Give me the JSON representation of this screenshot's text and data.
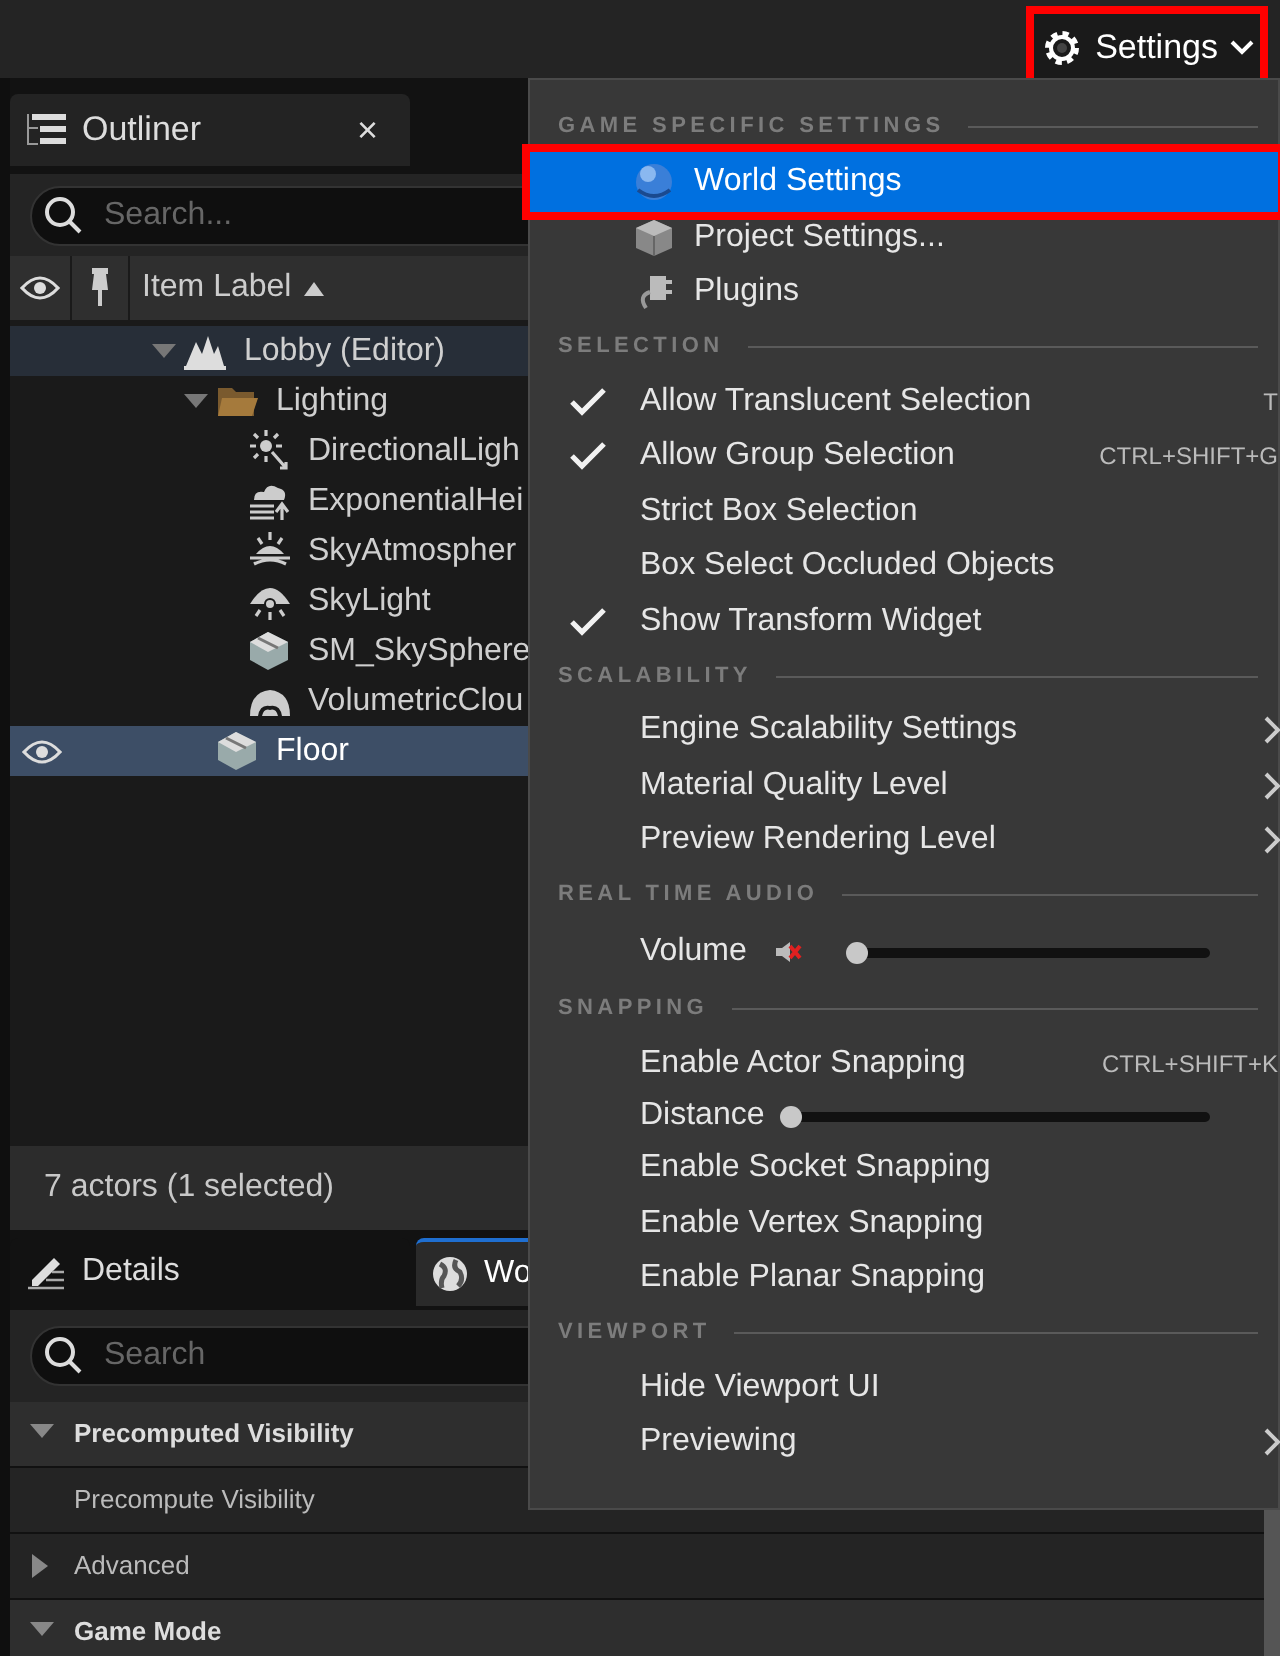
{
  "toolbar": {
    "settings_button": {
      "label": "Settings",
      "highlighted": true
    }
  },
  "outliner": {
    "tab": {
      "label": "Outliner",
      "close": "×"
    },
    "search": {
      "placeholder": "Search..."
    },
    "column": {
      "label": "Item Label"
    },
    "tree": [
      {
        "label": "Lobby (Editor)",
        "kind": "world",
        "selected": false,
        "expanded": true,
        "children": [
          {
            "label": "Lighting",
            "kind": "folder",
            "selected": false,
            "expanded": true,
            "children": [
              {
                "label": "DirectionalLigh",
                "kind": "directional-light",
                "selected": false
              },
              {
                "label": "ExponentialHei",
                "kind": "height-fog",
                "selected": false
              },
              {
                "label": "SkyAtmospher",
                "kind": "sky-atmosphere",
                "selected": false
              },
              {
                "label": "SkyLight",
                "kind": "sky-light",
                "selected": false
              },
              {
                "label": "SM_SkySphere",
                "kind": "mesh",
                "selected": false
              },
              {
                "label": "VolumetricClou",
                "kind": "cloud",
                "selected": false
              }
            ]
          },
          {
            "label": "Floor",
            "kind": "mesh",
            "selected": true
          }
        ]
      }
    ],
    "status": "7 actors (1 selected)"
  },
  "details": {
    "tabs": [
      {
        "label": "Details",
        "kind": "details",
        "selected": false
      },
      {
        "label": "Wo",
        "kind": "world",
        "selected": true
      }
    ],
    "search": {
      "placeholder": "Search"
    },
    "rows": [
      {
        "label": "Precomputed Visibility",
        "kind": "category",
        "expanded": true
      },
      {
        "label": "Precompute Visibility",
        "kind": "property"
      },
      {
        "label": "Advanced",
        "kind": "advanced",
        "expanded": false
      },
      {
        "label": "Game Mode",
        "kind": "category",
        "expanded": true
      }
    ]
  },
  "menu": {
    "sections": [
      {
        "header": "GAME SPECIFIC SETTINGS",
        "items": [
          {
            "kind": "icon",
            "label": "World Settings",
            "selected": true,
            "highlighted": true
          },
          {
            "kind": "icon",
            "label": "Project Settings...",
            "selected": false,
            "highlighted": false
          },
          {
            "kind": "icon",
            "label": "Plugins",
            "selected": false,
            "highlighted": false
          }
        ]
      },
      {
        "header": "SELECTION",
        "items": [
          {
            "kind": "check",
            "label": "Allow Translucent Selection",
            "checked": true,
            "shortcut": "T"
          },
          {
            "kind": "check",
            "label": "Allow Group Selection",
            "checked": true,
            "shortcut": "CTRL+SHIFT+G"
          },
          {
            "kind": "check",
            "label": "Strict Box Selection",
            "checked": false
          },
          {
            "kind": "check",
            "label": "Box Select Occluded Objects",
            "checked": false
          },
          {
            "kind": "check",
            "label": "Show Transform Widget",
            "checked": true
          }
        ]
      },
      {
        "header": "SCALABILITY",
        "items": [
          {
            "kind": "submenu",
            "label": "Engine Scalability Settings"
          },
          {
            "kind": "submenu",
            "label": "Material Quality Level"
          },
          {
            "kind": "submenu",
            "label": "Preview Rendering Level"
          }
        ]
      },
      {
        "header": "REAL TIME AUDIO",
        "items": [
          {
            "kind": "slider",
            "label": "Volume",
            "muted": true,
            "level": 0
          }
        ]
      },
      {
        "header": "SNAPPING",
        "items": [
          {
            "kind": "check",
            "label": "Enable Actor Snapping",
            "checked": false,
            "shortcut": "CTRL+SHIFT+K"
          },
          {
            "kind": "slider",
            "label": "Distance",
            "level": 0
          },
          {
            "kind": "check",
            "label": "Enable Socket Snapping",
            "checked": false
          },
          {
            "kind": "check",
            "label": "Enable Vertex Snapping",
            "checked": false
          },
          {
            "kind": "check",
            "label": "Enable Planar Snapping",
            "checked": false
          }
        ]
      },
      {
        "header": "VIEWPORT",
        "items": [
          {
            "kind": "check",
            "label": "Hide Viewport UI",
            "checked": false
          },
          {
            "kind": "submenu",
            "label": "Previewing"
          }
        ]
      }
    ]
  }
}
